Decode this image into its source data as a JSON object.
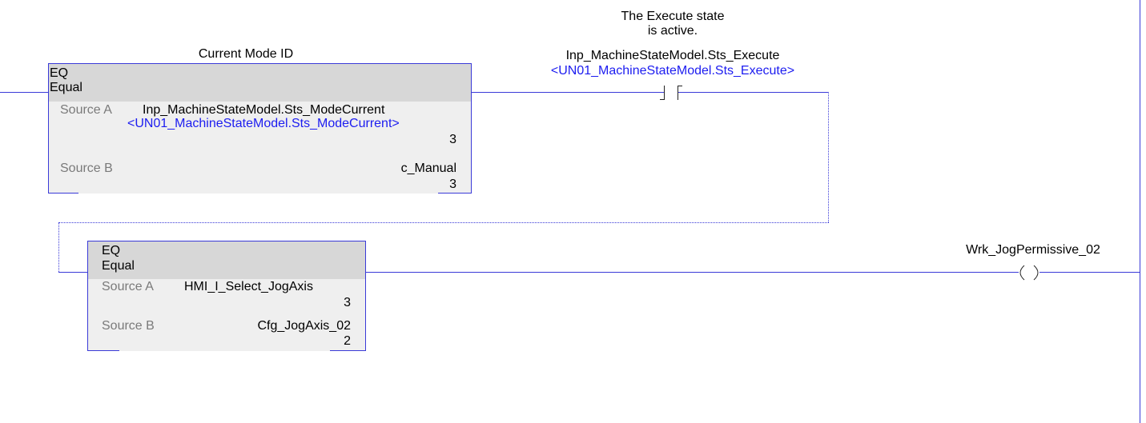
{
  "rung1": {
    "eq_block": {
      "title_comment": "Current Mode ID",
      "mnemonic": "EQ",
      "name": "Equal",
      "source_a_label": "Source A",
      "source_a_tag": "Inp_MachineStateModel.Sts_ModeCurrent",
      "source_a_alias": "<UN01_MachineStateModel.Sts_ModeCurrent>",
      "source_a_value": "3",
      "source_b_label": "Source B",
      "source_b_tag": "c_Manual",
      "source_b_value": "3"
    },
    "xic_contact": {
      "comment_line1": "The Execute state",
      "comment_line2": "is active.",
      "tag": "Inp_MachineStateModel.Sts_Execute",
      "alias": "<UN01_MachineStateModel.Sts_Execute>"
    }
  },
  "rung2": {
    "eq_block": {
      "mnemonic": "EQ",
      "name": "Equal",
      "source_a_label": "Source A",
      "source_a_tag": "HMI_I_Select_JogAxis",
      "source_a_value": "3",
      "source_b_label": "Source B",
      "source_b_tag": "Cfg_JogAxis_02",
      "source_b_value": "2"
    },
    "ote_coil": {
      "tag": "Wrk_JogPermissive_02"
    }
  },
  "colors": {
    "wire": "#3a3ad8",
    "alias_text": "#1c1cf0",
    "header_fill": "#d7d7d7",
    "body_fill": "#efefef",
    "label_gray": "#7a7a7a"
  }
}
